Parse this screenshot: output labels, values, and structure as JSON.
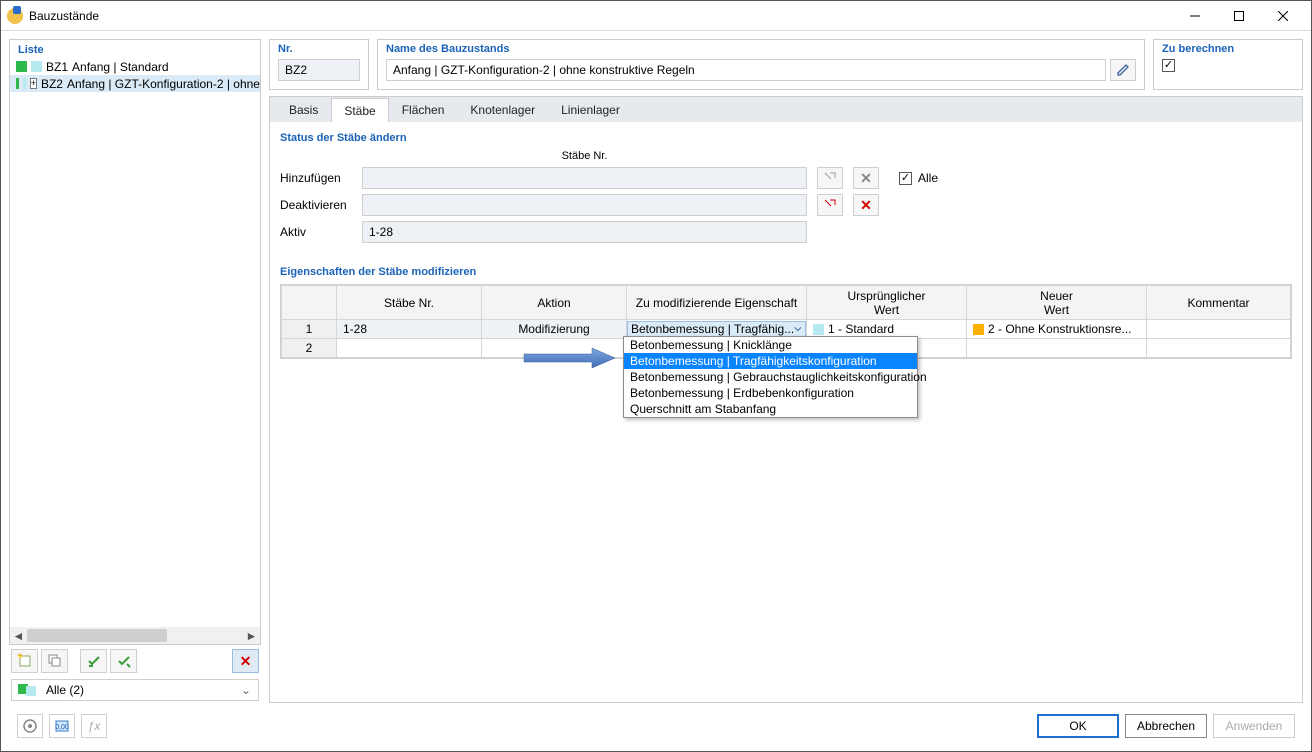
{
  "window": {
    "title": "Bauzustände"
  },
  "left": {
    "title": "Liste",
    "items": [
      {
        "code": "BZ1",
        "name": "Anfang | Standard",
        "selected": false,
        "color1": "#2fb84b",
        "color2": "#b7eaf0"
      },
      {
        "code": "BZ2",
        "name": "Anfang | GZT-Konfiguration-2 | ohne",
        "selected": true,
        "color1": "#2fb84b",
        "color2": "#b7eaf0"
      }
    ],
    "filter": "Alle (2)"
  },
  "header": {
    "nr_label": "Nr.",
    "nr_value": "BZ2",
    "name_label": "Name des Bauzustands",
    "name_value": "Anfang | GZT-Konfiguration-2 | ohne konstruktive Regeln",
    "calc_label": "Zu berechnen",
    "calc_checked": true
  },
  "tabs": {
    "items": [
      "Basis",
      "Stäbe",
      "Flächen",
      "Knotenlager",
      "Linienlager"
    ],
    "active": 1
  },
  "status_section": {
    "title": "Status der Stäbe ändern",
    "col_header": "Stäbe Nr.",
    "rows": {
      "add_label": "Hinzufügen",
      "add_value": "",
      "deact_label": "Deaktivieren",
      "deact_value": "",
      "active_label": "Aktiv",
      "active_value": "1-28"
    },
    "alle_label": "Alle",
    "alle_checked": true
  },
  "mod_section": {
    "title": "Eigenschaften der Stäbe modifizieren",
    "columns": {
      "c1": "Stäbe Nr.",
      "c2": "Aktion",
      "c3": "Zu modifizierende Eigenschaft",
      "c4a": "Ursprünglicher",
      "c4b": "Wert",
      "c5a": "Neuer",
      "c5b": "Wert",
      "c6": "Kommentar"
    },
    "rows": [
      {
        "num": "1",
        "staebe": "1-28",
        "aktion": "Modifizierung",
        "eigenschaft": "Betonbemessung | Tragfähig...",
        "orig_color": "#b7eaf0",
        "orig": "1 - Standard",
        "neu_color": "#ffb000",
        "neu": "2 - Ohne Konstruktionsre...",
        "kommentar": ""
      },
      {
        "num": "2",
        "staebe": "",
        "aktion": "",
        "eigenschaft": "",
        "orig": "",
        "neu": "",
        "kommentar": ""
      }
    ],
    "dropdown_options": [
      "Betonbemessung | Knicklänge",
      "Betonbemessung | Tragfähigkeitskonfiguration",
      "Betonbemessung | Gebrauchstauglichkeitskonfiguration",
      "Betonbemessung | Erdbebenkonfiguration",
      "Querschnitt am Stabanfang"
    ],
    "dropdown_selected": 1
  },
  "footer": {
    "ok": "OK",
    "cancel": "Abbrechen",
    "apply": "Anwenden"
  }
}
